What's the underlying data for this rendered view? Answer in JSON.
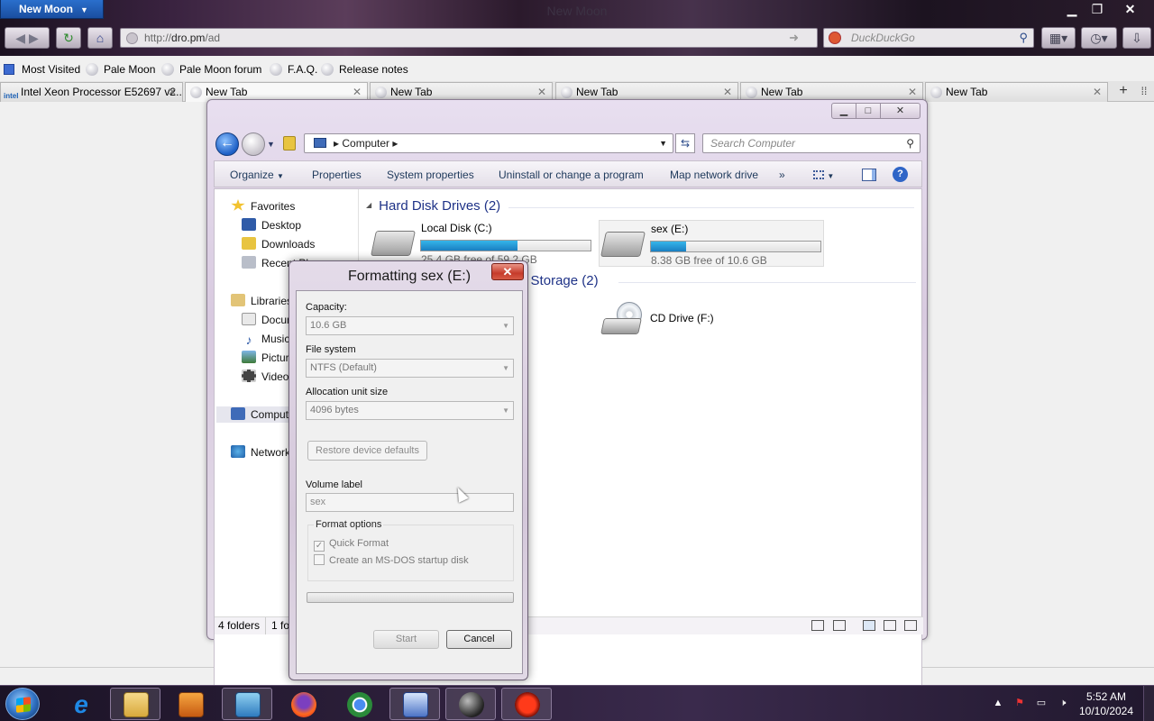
{
  "browser": {
    "app_menu_label": "New Moon",
    "window_title": "New Moon",
    "url_scheme": "http://",
    "url_host": "dro.pm",
    "url_path": "/ad",
    "search_placeholder": "DuckDuckGo",
    "search_engine_icon": "duckduckgo-icon"
  },
  "bookmarks": [
    {
      "label": "Most Visited",
      "icon": "bookmark-folder-icon"
    },
    {
      "label": "Pale Moon",
      "icon": "palemoon-icon"
    },
    {
      "label": "Pale Moon forum",
      "icon": "palemoon-icon"
    },
    {
      "label": "F.A.Q.",
      "icon": "palemoon-icon"
    },
    {
      "label": "Release notes",
      "icon": "palemoon-icon"
    }
  ],
  "tabs": [
    {
      "label": "Intel Xeon Processor E52697 v2...",
      "favicon": "intel-icon"
    },
    {
      "label": "New Tab",
      "favicon": "palemoon-icon",
      "active": true
    },
    {
      "label": "New Tab",
      "favicon": "palemoon-icon"
    },
    {
      "label": "New Tab",
      "favicon": "palemoon-icon"
    },
    {
      "label": "New Tab",
      "favicon": "palemoon-icon"
    },
    {
      "label": "New Tab",
      "favicon": "palemoon-icon"
    }
  ],
  "explorer": {
    "breadcrumb": "Computer",
    "search_placeholder": "Search Computer",
    "toolbar": {
      "organize": "Organize",
      "properties": "Properties",
      "system_properties": "System properties",
      "uninstall": "Uninstall or change a program",
      "map_drive": "Map network drive",
      "more": "»"
    },
    "nav": {
      "favorites": "Favorites",
      "desktop": "Desktop",
      "downloads": "Downloads",
      "recent": "Recent Places",
      "libraries": "Libraries",
      "documents": "Documents",
      "music": "Music",
      "pictures": "Pictures",
      "videos": "Videos",
      "computer": "Computer",
      "network": "Network"
    },
    "groups": {
      "hdd": "Hard Disk Drives (2)",
      "removable": "Devices with Removable Storage (2)"
    },
    "drives": [
      {
        "name": "Local Disk (C:)",
        "free": "25.4 GB free of 59.2 GB",
        "used_fraction": 0.571
      },
      {
        "name": "sex (E:)",
        "free": "8.38 GB free of 10.6 GB",
        "used_fraction": 0.209
      },
      {
        "name": "CD Drive (F:)"
      }
    ],
    "status": {
      "left": "4 folders",
      "right": "1 folder"
    }
  },
  "format_dialog": {
    "title": "Formatting sex (E:)",
    "capacity_label": "Capacity:",
    "capacity_value": "10.6 GB",
    "fs_label": "File system",
    "fs_value": "NTFS (Default)",
    "alloc_label": "Allocation unit size",
    "alloc_value": "4096 bytes",
    "restore_label": "Restore device defaults",
    "volume_label": "Volume label",
    "volume_value": "sex",
    "options_legend": "Format options",
    "quick_format": "Quick Format",
    "quick_format_checked": true,
    "msdos": "Create an MS-DOS startup disk",
    "msdos_checked": false,
    "progress": 0,
    "start_label": "Start",
    "cancel_label": "Cancel"
  },
  "taskbar": {
    "pinned": [
      "internet-explorer-icon",
      "file-explorer-icon",
      "media-player-icon",
      "control-panel-icon",
      "firefox-icon",
      "chrome-icon",
      "system-info-icon",
      "palemoon-icon",
      "record-icon"
    ],
    "time": "5:52 AM",
    "date": "10/10/2024"
  }
}
